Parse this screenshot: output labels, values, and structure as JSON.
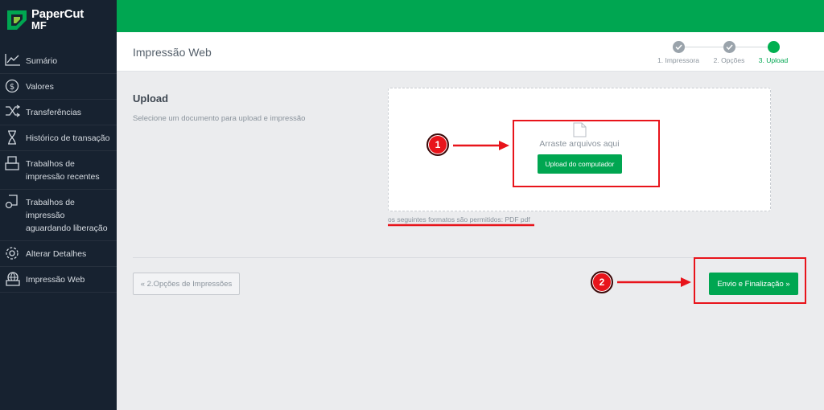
{
  "app": {
    "logo_line1": "PaperCut",
    "logo_line2": "MF"
  },
  "sidebar": {
    "items": [
      {
        "label": [
          "Sumário"
        ],
        "icon": "chart-line-icon"
      },
      {
        "label": [
          "Valores"
        ],
        "icon": "dollar-circle-icon"
      },
      {
        "label": [
          "Transferências"
        ],
        "icon": "shuffle-icon"
      },
      {
        "label": [
          "Histórico de transação"
        ],
        "icon": "hourglass-icon"
      },
      {
        "label": [
          "Trabalhos de",
          "impressão recentes"
        ],
        "icon": "printer-tray-icon"
      },
      {
        "label": [
          "Trabalhos de",
          "impressão",
          "aguardando liberação"
        ],
        "icon": "document-hold-icon"
      },
      {
        "label": [
          "Alterar Detalhes"
        ],
        "icon": "gear-icon"
      },
      {
        "label": [
          "Impressão Web"
        ],
        "icon": "web-print-icon"
      }
    ]
  },
  "header": {
    "title": "Impressão Web"
  },
  "steps": [
    {
      "label": "1. Impressora",
      "state": "done"
    },
    {
      "label": "2. Opções",
      "state": "done"
    },
    {
      "label": "3. Upload",
      "state": "active"
    }
  ],
  "upload": {
    "title": "Upload",
    "description": "Selecione um documento para upload e impressão",
    "drop_text": "Arraste arquivos aqui",
    "button": "Upload do computador",
    "formats": "os seguintes formatos são permitidos: PDF pdf"
  },
  "actions": {
    "back": "« 2.Opções de Impressões",
    "submit": "Envio e Finalização »"
  },
  "annotations": {
    "one": "1",
    "two": "2"
  },
  "colors": {
    "brand_green": "#00a651",
    "sidebar_bg": "#172230",
    "annotation_red": "#e8141b"
  }
}
